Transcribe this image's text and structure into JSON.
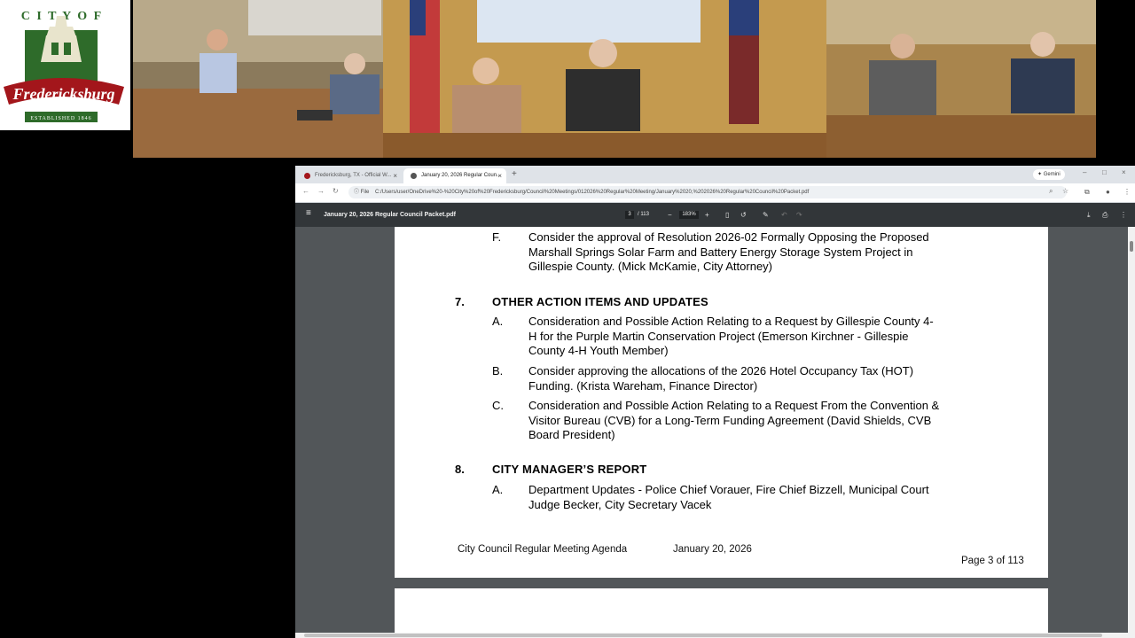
{
  "logo": {
    "arc_text": "CITY OF",
    "name": "Fredericksburg",
    "established": "ESTABLISHED 1846"
  },
  "video": {
    "description_free": true
  },
  "browser": {
    "tabs": [
      {
        "label": "Fredericksburg, TX - Official W...",
        "active": false
      },
      {
        "label": "January 20, 2026 Regular Coun...",
        "active": true
      }
    ],
    "gemini_label": "Gemini",
    "address": {
      "scheme_label": "File",
      "url": "C:/Users/user/OneDrive%20-%20City%20of%20Fredericksburg/Council%20Meetings/012026%20Regular%20Meeting/January%2020,%202026%20Regular%20Council%20Packet.pdf"
    }
  },
  "pdf": {
    "filename": "January 20, 2026 Regular Council Packet.pdf",
    "current_page": "3",
    "total_pages": "/ 113",
    "zoom": "183%"
  },
  "document": {
    "item_f": {
      "letter": "F.",
      "lines": [
        "Consider the approval of Resolution 2026-02 Formally Opposing the Proposed",
        "Marshall Springs Solar Farm and Battery Energy Storage System Project in",
        "Gillespie County. (Mick McKamie, City Attorney)"
      ]
    },
    "section7": {
      "number": "7.",
      "title": "OTHER ACTION ITEMS AND UPDATES",
      "items": [
        {
          "letter": "A.",
          "lines": [
            "Consideration and Possible Action Relating to a Request by Gillespie County 4-",
            "H for the Purple Martin Conservation Project (Emerson Kirchner - Gillespie",
            "County 4-H Youth Member)"
          ]
        },
        {
          "letter": "B.",
          "lines": [
            "Consider approving the allocations of the 2026 Hotel Occupancy Tax (HOT)",
            "Funding. (Krista Wareham, Finance Director)"
          ]
        },
        {
          "letter": "C.",
          "lines": [
            "Consideration and Possible Action Relating to a Request From the Convention &",
            "Visitor Bureau (CVB) for a Long-Term Funding Agreement (David Shields, CVB",
            "Board President)"
          ]
        }
      ]
    },
    "section8": {
      "number": "8.",
      "title": "CITY MANAGER’S REPORT",
      "items": [
        {
          "letter": "A.",
          "lines": [
            "Department Updates - Police Chief Vorauer, Fire Chief Bizzell, Municipal Court",
            "Judge Becker, City Secretary Vacek"
          ]
        }
      ]
    },
    "footer": {
      "left": "City Council Regular Meeting Agenda",
      "date": "January 20, 2026",
      "page": "Page 3 of 113"
    }
  },
  "colors": {
    "logo_green": "#2e6b2a",
    "logo_red": "#a3161b",
    "pdf_toolbar": "#323639",
    "pdf_bg": "#525659"
  }
}
